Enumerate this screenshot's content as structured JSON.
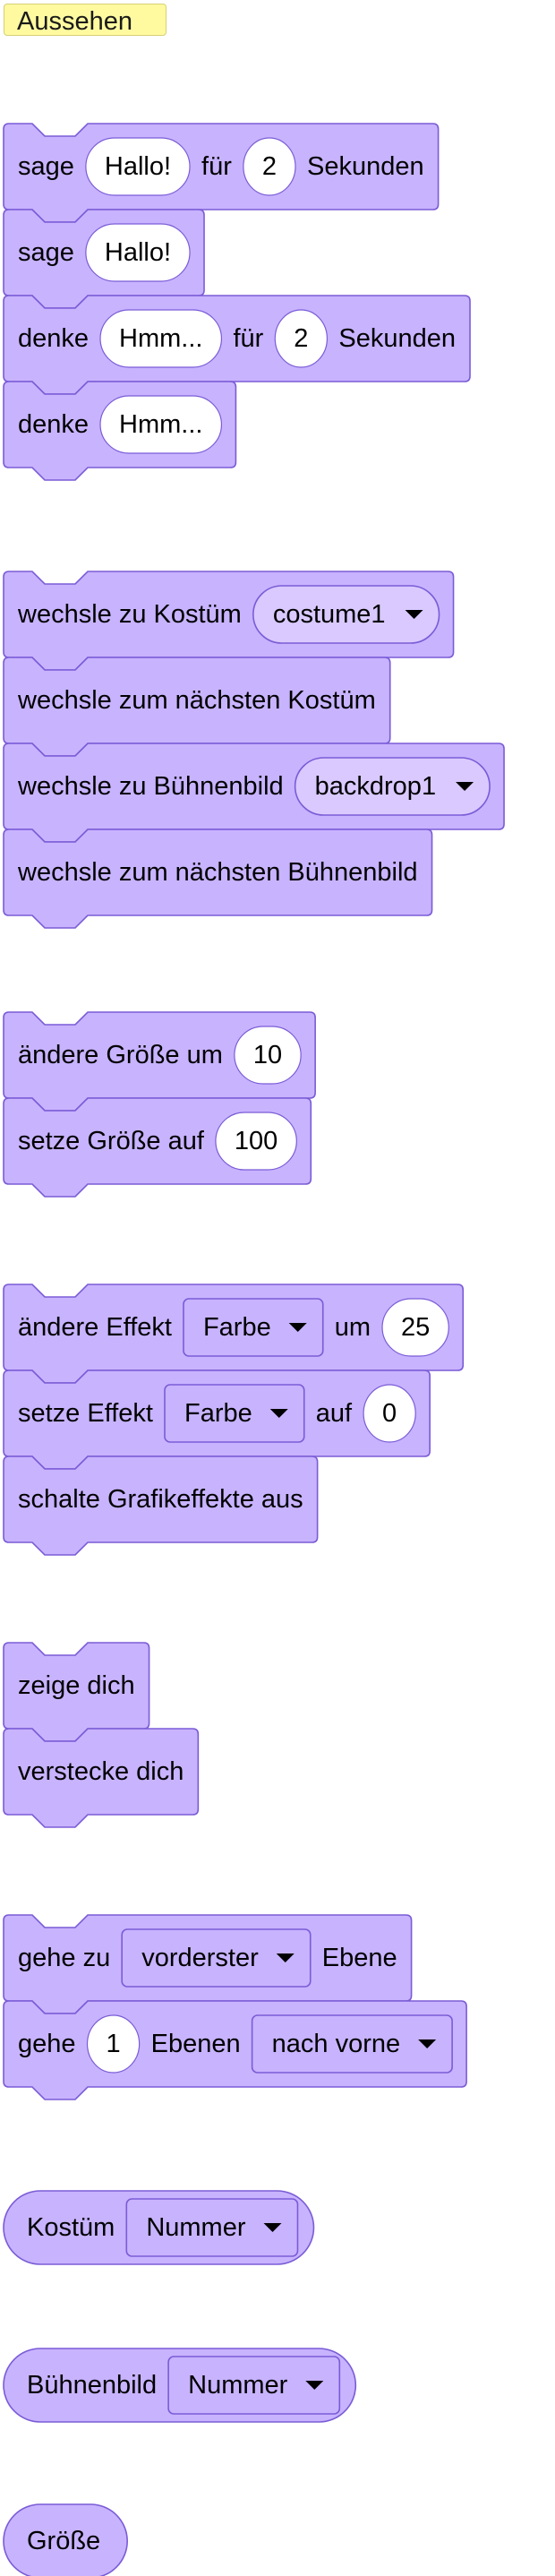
{
  "category": {
    "label": "Aussehen",
    "color": "#fffaa0",
    "border": "#d6d075"
  },
  "colors": {
    "block_fill": "#c8b3ff",
    "block_stroke": "#7a5cd6",
    "input_fill": "#ffffff",
    "dropdown_fill": "#c8b3ff",
    "text": "#000000"
  },
  "groups": [
    {
      "blocks": [
        {
          "name": "say-for-secs-block",
          "parts": [
            {
              "t": "text",
              "v": "sage"
            },
            {
              "t": "input",
              "v": "Hallo!"
            },
            {
              "t": "text",
              "v": "für"
            },
            {
              "t": "input",
              "v": "2"
            },
            {
              "t": "text",
              "v": "Sekunden"
            }
          ]
        },
        {
          "name": "say-block",
          "parts": [
            {
              "t": "text",
              "v": "sage"
            },
            {
              "t": "input",
              "v": "Hallo!"
            }
          ]
        },
        {
          "name": "think-for-secs-block",
          "parts": [
            {
              "t": "text",
              "v": "denke"
            },
            {
              "t": "input",
              "v": "Hmm..."
            },
            {
              "t": "text",
              "v": "für"
            },
            {
              "t": "input",
              "v": "2"
            },
            {
              "t": "text",
              "v": "Sekunden"
            }
          ]
        },
        {
          "name": "think-block",
          "parts": [
            {
              "t": "text",
              "v": "denke"
            },
            {
              "t": "input",
              "v": "Hmm..."
            }
          ]
        }
      ]
    },
    {
      "blocks": [
        {
          "name": "switch-costume-block",
          "parts": [
            {
              "t": "text",
              "v": "wechsle zu Kostüm"
            },
            {
              "t": "round-dropdown",
              "v": "costume1"
            }
          ]
        },
        {
          "name": "next-costume-block",
          "parts": [
            {
              "t": "text",
              "v": "wechsle zum nächsten Kostüm"
            }
          ]
        },
        {
          "name": "switch-backdrop-block",
          "parts": [
            {
              "t": "text",
              "v": "wechsle zu Bühnenbild"
            },
            {
              "t": "round-dropdown",
              "v": "backdrop1"
            }
          ]
        },
        {
          "name": "next-backdrop-block",
          "parts": [
            {
              "t": "text",
              "v": "wechsle zum nächsten Bühnenbild"
            }
          ]
        }
      ]
    },
    {
      "blocks": [
        {
          "name": "change-size-block",
          "parts": [
            {
              "t": "text",
              "v": "ändere Größe um"
            },
            {
              "t": "input",
              "v": "10"
            }
          ]
        },
        {
          "name": "set-size-block",
          "parts": [
            {
              "t": "text",
              "v": "setze Größe auf"
            },
            {
              "t": "input",
              "v": "100"
            }
          ]
        }
      ]
    },
    {
      "blocks": [
        {
          "name": "change-effect-block",
          "parts": [
            {
              "t": "text",
              "v": "ändere Effekt"
            },
            {
              "t": "dropdown",
              "v": "Farbe"
            },
            {
              "t": "text",
              "v": "um"
            },
            {
              "t": "input",
              "v": "25"
            }
          ]
        },
        {
          "name": "set-effect-block",
          "parts": [
            {
              "t": "text",
              "v": "setze Effekt"
            },
            {
              "t": "dropdown",
              "v": "Farbe"
            },
            {
              "t": "text",
              "v": "auf"
            },
            {
              "t": "input",
              "v": "0"
            }
          ]
        },
        {
          "name": "clear-effects-block",
          "parts": [
            {
              "t": "text",
              "v": "schalte Grafikeffekte aus"
            }
          ]
        }
      ]
    },
    {
      "blocks": [
        {
          "name": "show-block",
          "parts": [
            {
              "t": "text",
              "v": "zeige dich"
            }
          ]
        },
        {
          "name": "hide-block",
          "parts": [
            {
              "t": "text",
              "v": "verstecke dich"
            }
          ]
        }
      ]
    },
    {
      "blocks": [
        {
          "name": "go-to-layer-block",
          "parts": [
            {
              "t": "text",
              "v": "gehe zu"
            },
            {
              "t": "dropdown",
              "v": "vorderster"
            },
            {
              "t": "text",
              "v": "Ebene"
            }
          ]
        },
        {
          "name": "go-layers-block",
          "parts": [
            {
              "t": "text",
              "v": "gehe"
            },
            {
              "t": "input",
              "v": "1"
            },
            {
              "t": "text",
              "v": "Ebenen"
            },
            {
              "t": "dropdown",
              "v": "nach vorne"
            }
          ]
        }
      ]
    }
  ],
  "reporters": [
    {
      "name": "costume-reporter",
      "parts": [
        {
          "t": "text",
          "v": "Kostüm"
        },
        {
          "t": "dropdown",
          "v": "Nummer"
        }
      ]
    },
    {
      "name": "backdrop-reporter",
      "parts": [
        {
          "t": "text",
          "v": "Bühnenbild"
        },
        {
          "t": "dropdown",
          "v": "Nummer"
        }
      ]
    },
    {
      "name": "size-reporter",
      "parts": [
        {
          "t": "text",
          "v": "Größe"
        }
      ]
    }
  ]
}
